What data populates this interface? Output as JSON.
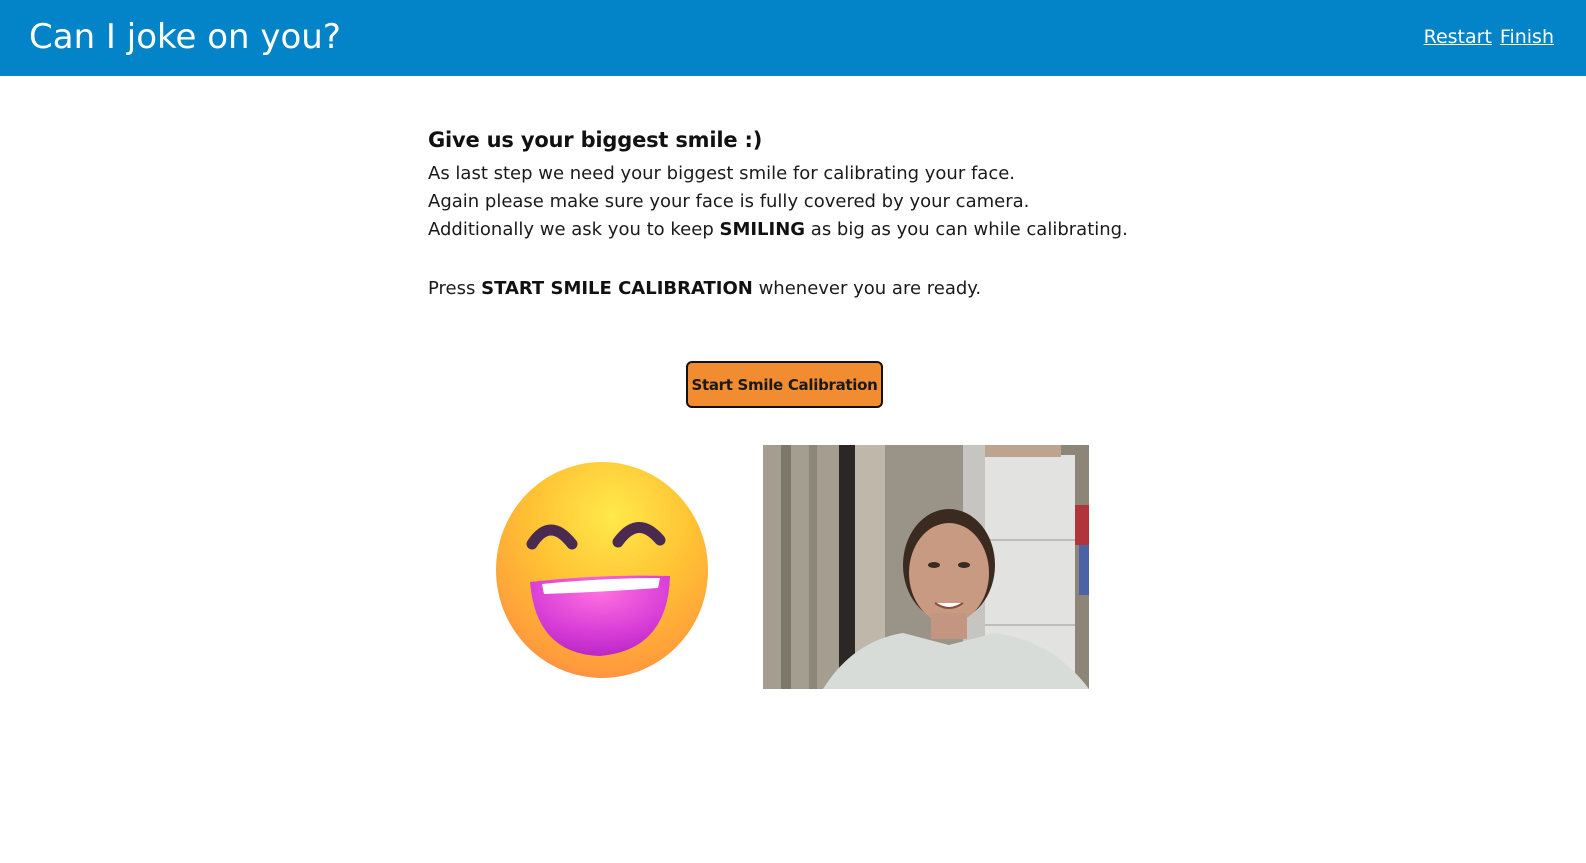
{
  "header": {
    "title": "Can I joke on you?",
    "nav": {
      "restart_label": "Restart",
      "finish_label": "Finish"
    },
    "background_color": "#0384c8"
  },
  "main": {
    "heading": "Give us your biggest smile :)",
    "lines": {
      "line1": "As last step we need your biggest smile for calibrating your face.",
      "line2": "Again please make sure your face is fully covered by your camera.",
      "line3_before": "Additionally we ask you to keep ",
      "line3_bold": "SMILING",
      "line3_after": " as big as you can while calibrating.",
      "press_before": "Press ",
      "press_bold": "START SMILE CALIBRATION",
      "press_after": " whenever you are ready."
    },
    "button_label": "Start Smile Calibration",
    "button_color": "#f28c30"
  },
  "media": {
    "emoji_icon": "grinning-face-with-smiling-eyes-icon",
    "camera_feed": "webcam-video"
  }
}
